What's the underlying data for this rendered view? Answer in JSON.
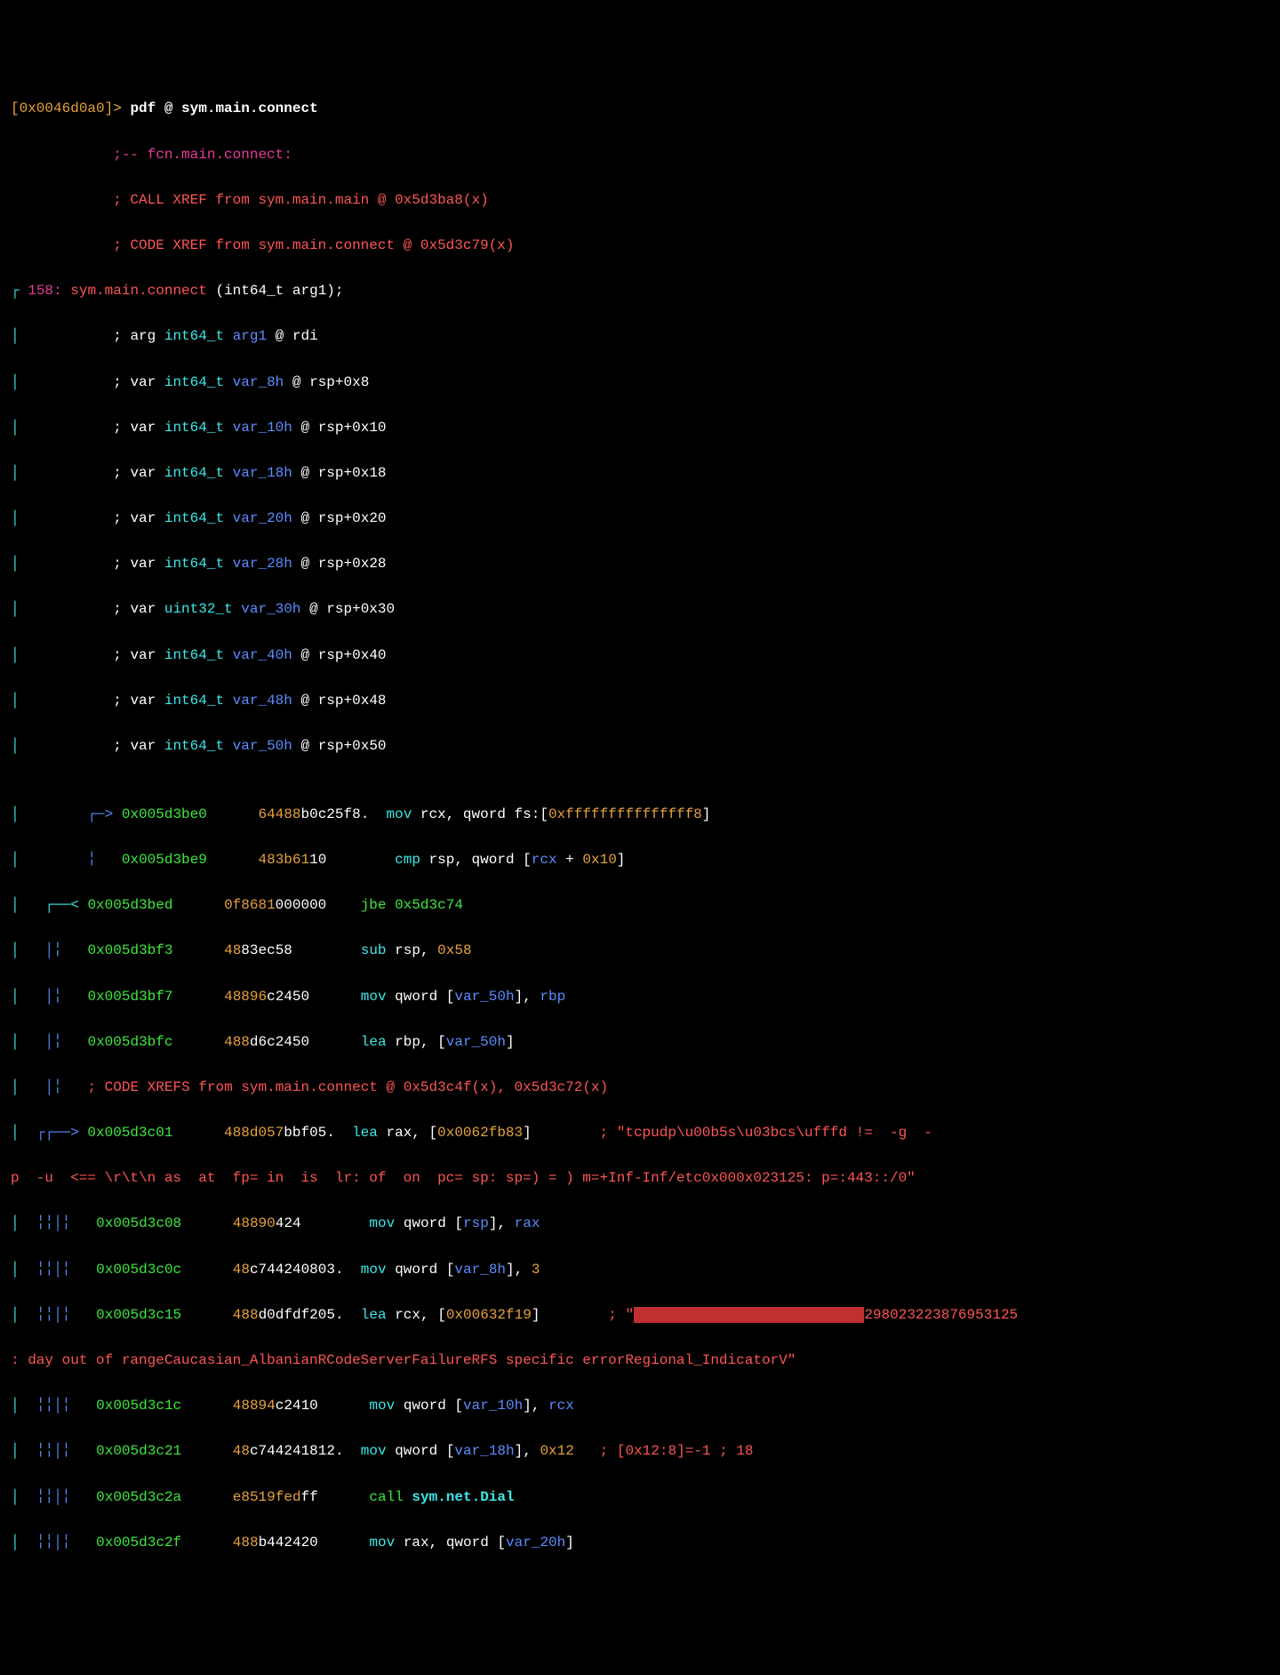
{
  "prompt": {
    "addr": "[0x0046d0a0]",
    "gt": ">",
    "cmd": "pdf @ sym.main.connect"
  },
  "head": {
    "fcn": ";-- fcn.main.connect:",
    "xref1": "; CALL XREF from sym.main.main @ 0x5d3ba8(x)",
    "xref2": "; CODE XREF from sym.main.connect @ 0x5d3c79(x)"
  },
  "sig": {
    "pipe": "┌",
    "size": "158:",
    "name": "sym.main.connect",
    "proto": "(int64_t arg1);"
  },
  "vars": {
    "v0": {
      "prefix": "; arg ",
      "type": "int64_t",
      "name": "arg1",
      "at": " @ ",
      "loc": "rdi"
    },
    "v1": {
      "prefix": "; var ",
      "type": "int64_t",
      "name": "var_8h",
      "at": " @ ",
      "loc": "rsp+0x8"
    },
    "v2": {
      "prefix": "; var ",
      "type": "int64_t",
      "name": "var_10h",
      "at": " @ ",
      "loc": "rsp+0x10"
    },
    "v3": {
      "prefix": "; var ",
      "type": "int64_t",
      "name": "var_18h",
      "at": " @ ",
      "loc": "rsp+0x18"
    },
    "v4": {
      "prefix": "; var ",
      "type": "int64_t",
      "name": "var_20h",
      "at": " @ ",
      "loc": "rsp+0x20"
    },
    "v5": {
      "prefix": "; var ",
      "type": "int64_t",
      "name": "var_28h",
      "at": " @ ",
      "loc": "rsp+0x28"
    },
    "v6": {
      "prefix": "; var ",
      "type": "uint32_t",
      "name": "var_30h",
      "at": " @ ",
      "loc": "rsp+0x30"
    },
    "v7": {
      "prefix": "; var ",
      "type": "int64_t",
      "name": "var_40h",
      "at": " @ ",
      "loc": "rsp+0x40"
    },
    "v8": {
      "prefix": "; var ",
      "type": "int64_t",
      "name": "var_48h",
      "at": " @ ",
      "loc": "rsp+0x48"
    },
    "v9": {
      "prefix": "; var ",
      "type": "int64_t",
      "name": "var_50h",
      "at": " @ ",
      "loc": "rsp+0x50"
    }
  },
  "ins": {
    "i0": {
      "arrow": "   ┌─> ",
      "addr": "0x005d3be0",
      "bytes1": "64488",
      "bytes2": "b0c25f8.",
      "op": "mov",
      "d1": "rcx, qword fs:[",
      "imm": "0xfffffffffffffff8",
      "d2": "]"
    },
    "i1": {
      "arrow": "   ╎   ",
      "addr": "0x005d3be9",
      "bytes1": "483b61",
      "bytes2": "10",
      "op": "cmp",
      "d1": "rsp, qword [",
      "reg": "rcx",
      "d2": " + ",
      "imm": "0x10",
      "d3": "]"
    },
    "i2": {
      "arrow": "┌──< ",
      "addr": "0x005d3bed",
      "bytes1": "0f8681",
      "bytes2": "000000",
      "op": "jbe",
      "tgt": "0x5d3c74"
    },
    "i3": {
      "arrow": "│╎   ",
      "addr": "0x005d3bf3",
      "bytes1": "48",
      "bytes2": "83ec58",
      "op": "sub",
      "d1": "rsp, ",
      "imm": "0x58"
    },
    "i4": {
      "arrow": "│╎   ",
      "addr": "0x005d3bf7",
      "bytes1": "48896",
      "bytes2": "c2450",
      "op": "mov",
      "d1": "qword [",
      "var": "var_50h",
      "d2": "], ",
      "reg": "rbp"
    },
    "i5": {
      "arrow": "│╎   ",
      "addr": "0x005d3bfc",
      "bytes1": "488",
      "bytes2": "d6c2450",
      "op": "lea",
      "d1": "rbp, [",
      "var": "var_50h",
      "d2": "]"
    },
    "xr": {
      "arrow": "│╎   ",
      "txt": "; CODE XREFS from sym.main.connect @ 0x5d3c4f(x), 0x5d3c72(x)"
    },
    "i6": {
      "arrow": "┌┌──> ",
      "addr": "0x005d3c01",
      "bytes1": "488d057",
      "bytes2": "bbf05.",
      "op": "lea",
      "d1": "rax, [",
      "imm": "0x0062fb83",
      "d2": "]",
      "cmt1": "; \"tcpudp\\u00b5s\\u03bcs\\ufffd != ",
      "cmt2": " -g  -",
      "cmt3": "p  -u  <== \\r\\t\\n as  at  fp= in  is  lr: of  on  pc= sp: sp=) = ) m=+Inf-Inf/etc0x000x023125: p=:443::/0\""
    },
    "i7": {
      "arrow": "╎╎│╎   ",
      "addr": "0x005d3c08",
      "bytes1": "48890",
      "bytes2": "424",
      "op": "mov",
      "d1": "qword [",
      "reg": "rsp",
      "d2": "], ",
      "reg2": "rax"
    },
    "i8": {
      "arrow": "╎╎│╎   ",
      "addr": "0x005d3c0c",
      "bytes1": "48",
      "bytes2": "c744240803.",
      "op": "mov",
      "d1": "qword [",
      "var": "var_8h",
      "d2": "], ",
      "imm": "3"
    },
    "i9": {
      "arrow": "╎╎│╎   ",
      "addr": "0x005d3c15",
      "bytes1": "488",
      "bytes2": "d0dfdf205.",
      "op": "lea",
      "d1": "rcx, [",
      "imm": "0x00632f19",
      "d2": "]",
      "cmt1": "; \"",
      "censor": "XXXXXXXXXXXXXXXXXXXXXXXXXXX",
      "cmt2": "298023223876953125",
      "cmt3": ": day out of rangeCaucasian_AlbanianRCodeServerFailureRFS specific errorRegional_IndicatorV\""
    },
    "i10": {
      "arrow": "╎╎│╎   ",
      "addr": "0x005d3c1c",
      "bytes1": "48894",
      "bytes2": "c2410",
      "op": "mov",
      "d1": "qword [",
      "var": "var_10h",
      "d2": "], ",
      "reg": "rcx"
    },
    "i11": {
      "arrow": "╎╎│╎   ",
      "addr": "0x005d3c21",
      "bytes1": "48",
      "bytes2": "c744241812.",
      "op": "mov",
      "d1": "qword [",
      "var": "var_18h",
      "d2": "], ",
      "imm": "0x12",
      "cmt": "; [0x12:8]=-1 ; 18"
    },
    "i12": {
      "arrow": "╎╎│╎   ",
      "addr": "0x005d3c2a",
      "bytes1": "e8519fed",
      "bytes2": "ff",
      "op": "call",
      "tgt": "sym.net.Dial"
    },
    "i13": {
      "arrow": "╎╎│╎   ",
      "addr": "0x005d3c2f",
      "bytes1": "488",
      "bytes2": "b442420",
      "op": "mov",
      "d1": "rax, qword [",
      "var": "var_20h",
      "d2": "]"
    }
  }
}
